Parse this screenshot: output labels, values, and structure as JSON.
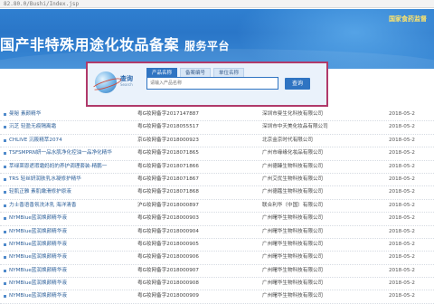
{
  "address_bar": {
    "text": "82.80.0/Bushi/Index.jsp"
  },
  "banner": {
    "title": "国产非特殊用途化妆品备案",
    "subtitle": "服务平台",
    "top_link": "国家食药监督"
  },
  "search": {
    "logo_text": "查询",
    "logo_sub": "Search",
    "tabs": [
      {
        "label": "产品名称",
        "active": true
      },
      {
        "label": "备案编号",
        "active": false
      },
      {
        "label": "单位名称",
        "active": false
      }
    ],
    "input_placeholder": "请输入产品名称",
    "button_label": "查询"
  },
  "records": [
    {
      "name": "曼秘 素颜精华",
      "number": "粤G妆网备字2017147887",
      "company": "深圳市曼生化科技有限公司",
      "date": "2018-05-2"
    },
    {
      "name": "沉芝 轻盈无痕隔离霜",
      "number": "粤G妆网备字2018055517",
      "company": "深圳市中天美化妆品有限公司",
      "date": "2018-05-2"
    },
    {
      "name": "CHLIVE 沉筱精萃2074",
      "number": "京G妆网备字2018000923",
      "company": "北京金京时代有限公司",
      "date": "2018-05-2"
    },
    {
      "name": "TSFSMPRN妍一品水肌净化控油一品净化精华",
      "number": "粤G妆网备字2018071865",
      "company": "广州市缘缘化妆品有限公司",
      "date": "2018-05-2"
    },
    {
      "name": "萃绿莱恩遮瑕霜妈妈的养护调理套装-精鹏一",
      "number": "粤G妆网备字2018071866",
      "company": "广州德臻生物科技有限公司",
      "date": "2018-05-2"
    },
    {
      "name": "TRS 轻丝妍润肤乳水凝修护精华",
      "number": "粤G妆网备字2018071867",
      "company": "广州艾优生物科技有限公司",
      "date": "2018-05-2"
    },
    {
      "name": "轻肌正雅 素肌嫩滑修护原液",
      "number": "粤G妆网备字2018071868",
      "company": "广州德蔻生物科技有限公司",
      "date": "2018-05-2"
    },
    {
      "name": "力士香语香氛洗沐乳 海洋清香",
      "number": "沪G妆网备字2018000897",
      "company": "联合利华（中国）有限公司",
      "date": "2018-05-2"
    },
    {
      "name": "NYMBlue蓝润焕颜精华液",
      "number": "粤G妆网备字2018000903",
      "company": "广州曙华生物科技有限公司",
      "date": "2018-05-2"
    },
    {
      "name": "NYMBlue蓝润焕颜精华液",
      "number": "粤G妆网备字2018000904",
      "company": "广州曙华生物科技有限公司",
      "date": "2018-05-2"
    },
    {
      "name": "NYMBlue蓝润焕颜精华液",
      "number": "粤G妆网备字2018000905",
      "company": "广州曙华生物科技有限公司",
      "date": "2018-05-2"
    },
    {
      "name": "NYMBlue蓝润焕颜精华液",
      "number": "粤G妆网备字2018000906",
      "company": "广州曙华生物科技有限公司",
      "date": "2018-05-2"
    },
    {
      "name": "NYMBlue蓝润焕颜精华液",
      "number": "粤G妆网备字2018000907",
      "company": "广州曙华生物科技有限公司",
      "date": "2018-05-2"
    },
    {
      "name": "NYMBlue蓝润焕颜精华液",
      "number": "粤G妆网备字2018000908",
      "company": "广州曙华生物科技有限公司",
      "date": "2018-05-2"
    },
    {
      "name": "NYMBlue蓝润焕颜精华液",
      "number": "粤G妆网备字2018000909",
      "company": "广州曙华生物科技有限公司",
      "date": "2018-05-2"
    }
  ]
}
